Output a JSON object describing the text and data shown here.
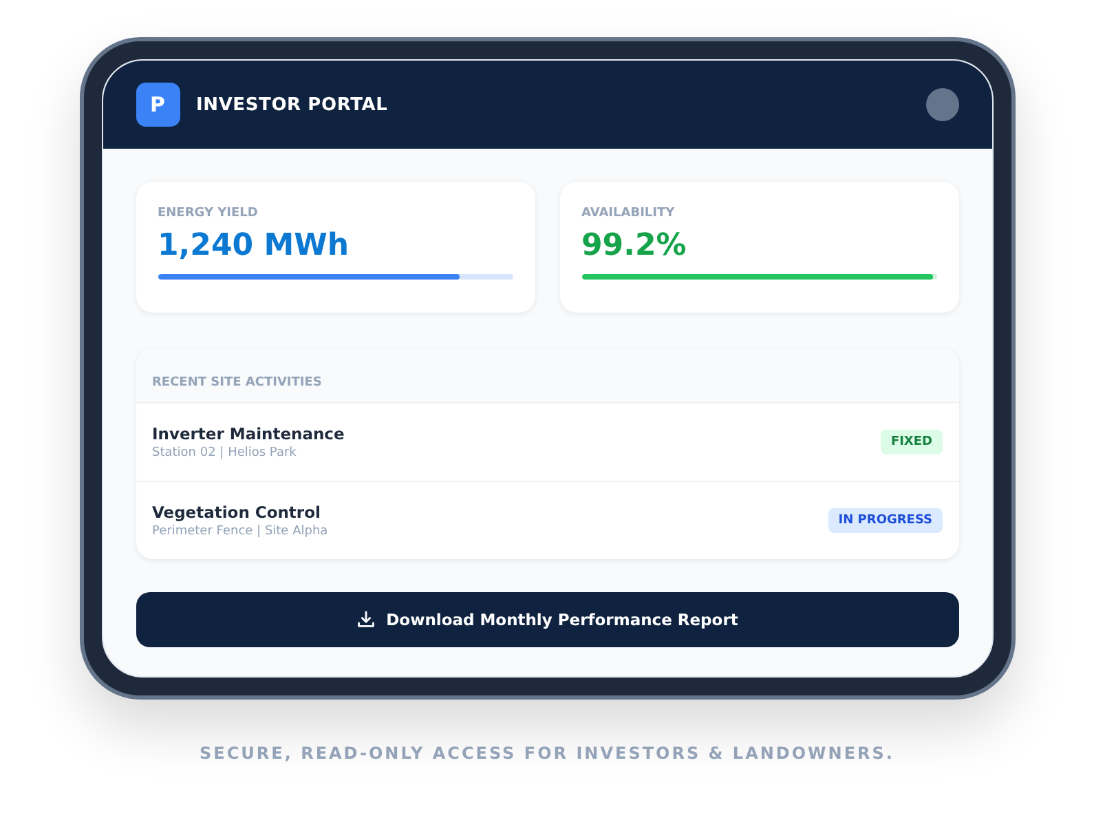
{
  "header": {
    "logo": "P",
    "title": "INVESTOR PORTAL"
  },
  "metrics": [
    {
      "label": "ENERGY YIELD",
      "value": "1,240 MWh",
      "level": 0.85,
      "color": "#3b82f6"
    },
    {
      "label": "AVAILABILITY",
      "value": "99.2%",
      "level": 0.992,
      "color": "#22c55e"
    }
  ],
  "activities": {
    "title": "RECENT SITE ACTIVITIES",
    "items": [
      {
        "name": "Inverter Maintenance",
        "detail": "Station 02 | Helios Park",
        "status": "FIXED",
        "kind": "fixed"
      },
      {
        "name": "Vegetation Control",
        "detail": "Perimeter Fence | Site Alpha",
        "status": "IN PROGRESS",
        "kind": "progress"
      }
    ]
  },
  "download_button": "Download Monthly Performance Report",
  "caption": "SECURE, READ-ONLY ACCESS FOR INVESTORS & LANDOWNERS."
}
